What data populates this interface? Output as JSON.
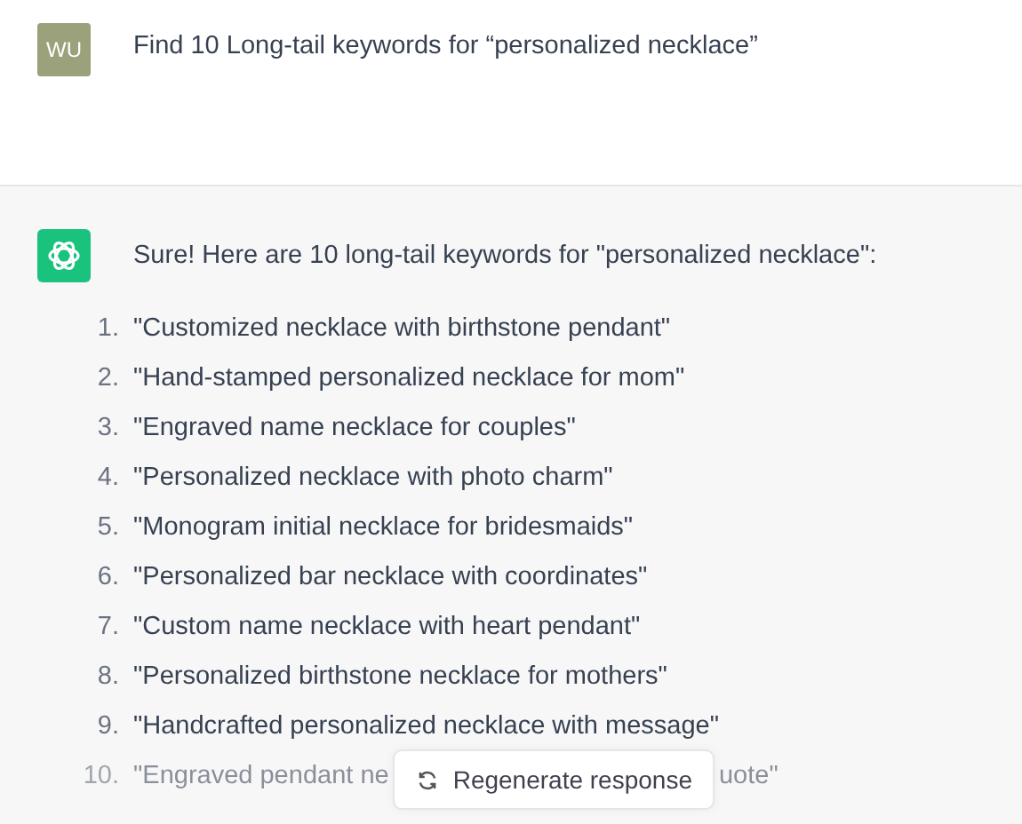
{
  "user_message": {
    "avatar": "WU",
    "text": "Find 10 Long-tail keywords for “personalized necklace”"
  },
  "assistant_message": {
    "intro": "Sure! Here are 10 long-tail keywords for \"personalized necklace\":",
    "items": [
      {
        "number": "1.",
        "text": "\"Customized necklace with birthstone pendant\""
      },
      {
        "number": "2.",
        "text": "\"Hand-stamped personalized necklace for mom\""
      },
      {
        "number": "3.",
        "text": "\"Engraved name necklace for couples\""
      },
      {
        "number": "4.",
        "text": "\"Personalized necklace with photo charm\""
      },
      {
        "number": "5.",
        "text": "\"Monogram initial necklace for bridesmaids\""
      },
      {
        "number": "6.",
        "text": "\"Personalized bar necklace with coordinates\""
      },
      {
        "number": "7.",
        "text": "\"Custom name necklace with heart pendant\""
      },
      {
        "number": "8.",
        "text": "\"Personalized birthstone necklace for mothers\""
      },
      {
        "number": "9.",
        "text": "\"Handcrafted personalized necklace with message\""
      },
      {
        "number": "10.",
        "text": "\"Engraved pendant ne",
        "text_after": "uote\""
      }
    ]
  },
  "regenerate_button": {
    "label": "Regenerate response"
  }
}
